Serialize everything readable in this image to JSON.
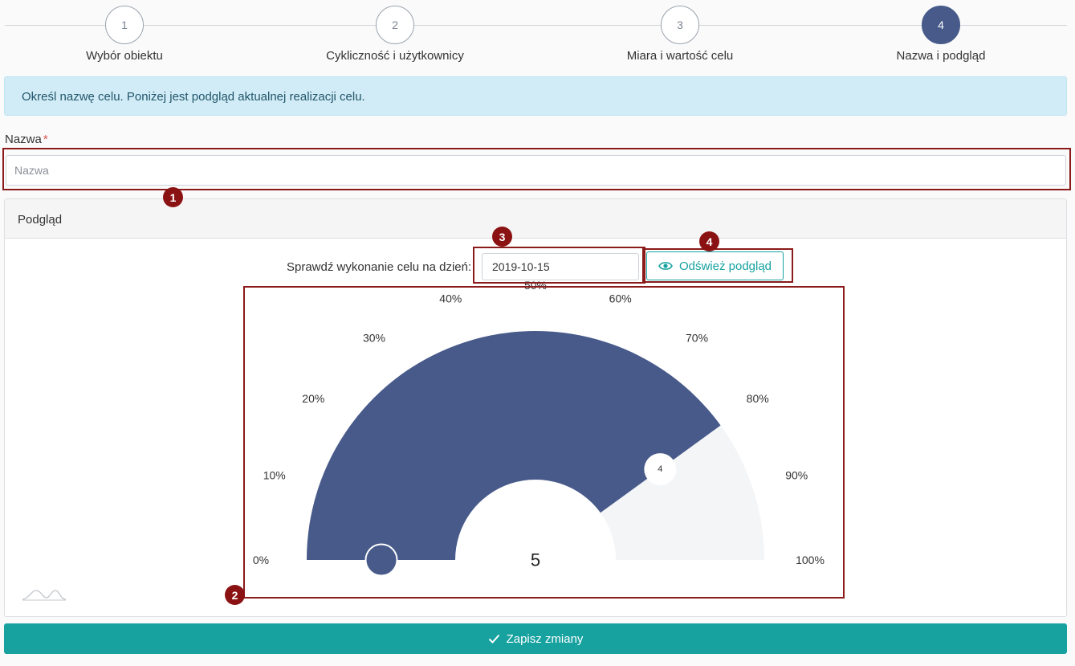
{
  "stepper": {
    "steps": [
      {
        "number": "1",
        "label": "Wybór obiektu",
        "active": false
      },
      {
        "number": "2",
        "label": "Cykliczność i użytkownicy",
        "active": false
      },
      {
        "number": "3",
        "label": "Miara i wartość celu",
        "active": false
      },
      {
        "number": "4",
        "label": "Nazwa i podgląd",
        "active": true
      }
    ]
  },
  "alert": {
    "text": "Określ nazwę celu. Poniżej jest podgląd aktualnej realizacji celu."
  },
  "name_field": {
    "label": "Nazwa",
    "required_marker": "*",
    "value": "",
    "placeholder": "Nazwa"
  },
  "preview": {
    "header": "Podgląd",
    "date_label": "Sprawdź wykonanie celu na dzień:",
    "date_value": "2019-10-15",
    "refresh_label": "Odśwież podgląd",
    "gauge": {
      "tick_labels": [
        "0%",
        "10%",
        "20%",
        "30%",
        "40%",
        "50%",
        "60%",
        "70%",
        "80%",
        "90%",
        "100%"
      ],
      "center_value": "5",
      "marker_value": "4",
      "filled_fraction": 0.8,
      "fill_color": "#475a8a",
      "track_color": "#f4f5f7"
    }
  },
  "annotations": [
    "1",
    "2",
    "3",
    "4"
  ],
  "save_label": "Zapisz zmiany",
  "colors": {
    "accent": "#17a2a0",
    "step_active": "#475a8a",
    "annotation": "#8b1212",
    "alert_bg": "#d1ecf6"
  }
}
